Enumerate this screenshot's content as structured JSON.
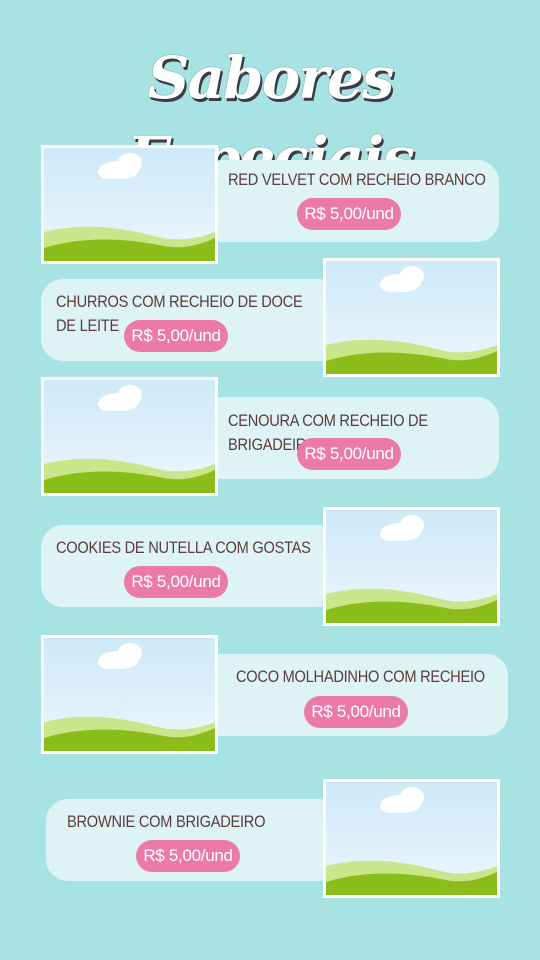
{
  "title": "Sabores Especiais",
  "items": [
    {
      "name": "RED VELVET COM RECHEIO BRANCO",
      "price": "R$ 5,00/und",
      "image": "landscape-placeholder-image"
    },
    {
      "name": "CHURROS COM RECHEIO DE DOCE DE LEITE",
      "price": "R$ 5,00/und",
      "image": "landscape-placeholder-image"
    },
    {
      "name": "CENOURA COM RECHEIO DE BRIGADEIRO",
      "price": "R$ 5,00/und",
      "image": "landscape-placeholder-image"
    },
    {
      "name": "COOKIES DE NUTELLA COM GOSTAS",
      "price": "R$ 5,00/und",
      "image": "landscape-placeholder-image"
    },
    {
      "name": "COCO MOLHADINHO COM RECHEIO",
      "price": "R$ 5,00/und",
      "image": "landscape-placeholder-image"
    },
    {
      "name": "BROWNIE COM BRIGADEIRO",
      "price": "R$ 5,00/und",
      "image": "landscape-placeholder-image"
    }
  ],
  "colors": {
    "background": "#a6e3e2",
    "card": "#def3f3",
    "price_badge": "#ec7aa7",
    "text": "#5c3b3b"
  }
}
